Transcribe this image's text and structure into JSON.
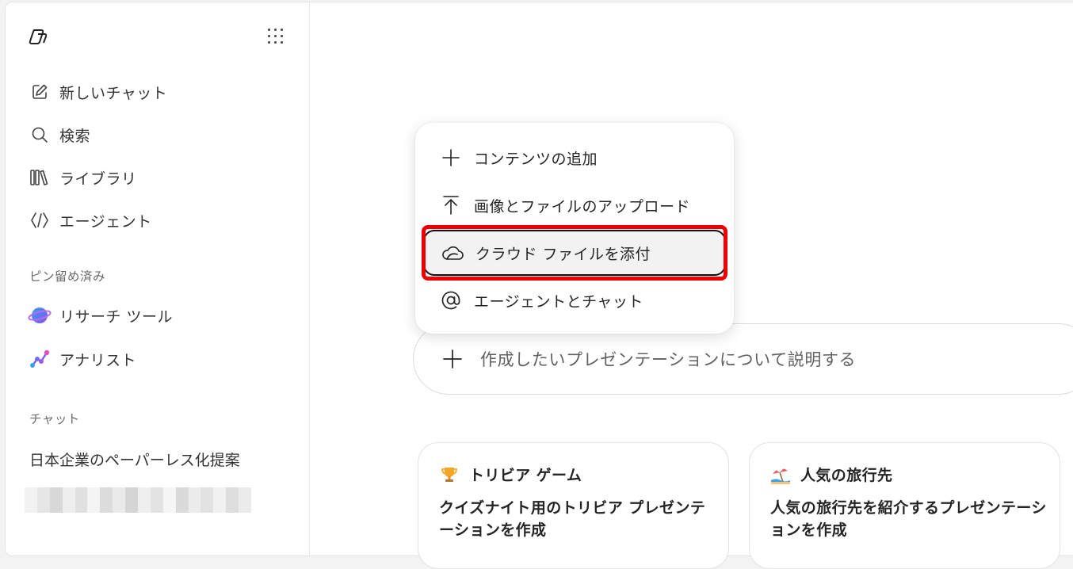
{
  "sidebar": {
    "nav": [
      {
        "label": "新しいチャット",
        "icon": "compose-icon"
      },
      {
        "label": "検索",
        "icon": "search-icon"
      },
      {
        "label": "ライブラリ",
        "icon": "library-icon"
      },
      {
        "label": "エージェント",
        "icon": "agent-icon"
      }
    ],
    "pinned_label": "ピン留め済み",
    "pinned": [
      {
        "label": "リサーチ ツール",
        "icon": "researcher-icon"
      },
      {
        "label": "アナリスト",
        "icon": "analyst-icon"
      }
    ],
    "chats_label": "チャット",
    "chats": [
      {
        "label": "日本企業のペーパーレス化提案"
      }
    ]
  },
  "menu": {
    "items": [
      {
        "label": "コンテンツの追加",
        "icon": "plus-icon"
      },
      {
        "label": "画像とファイルのアップロード",
        "icon": "upload-icon"
      },
      {
        "label": "クラウド ファイルを添付",
        "icon": "cloud-icon"
      },
      {
        "label": "エージェントとチャット",
        "icon": "at-icon"
      }
    ],
    "active_index": 2
  },
  "composer": {
    "placeholder": "作成したいプレゼンテーションについて説明する"
  },
  "cards": [
    {
      "title": "トリビア ゲーム",
      "icon": "trophy-icon",
      "description": "クイズナイト用のトリビア プレゼンテーションを作成"
    },
    {
      "title": "人気の旅行先",
      "icon": "beach-icon",
      "description": "人気の旅行先を紹介するプレゼンテーションを作成"
    }
  ],
  "colors": {
    "highlight": "#ee0000",
    "accent_purple": "#7b5cf0",
    "accent_blue": "#3aa0f0"
  }
}
